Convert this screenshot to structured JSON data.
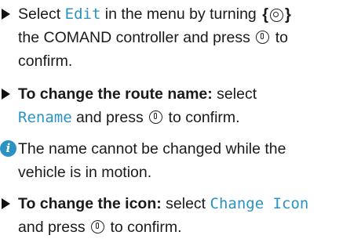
{
  "steps": [
    {
      "prefix": "Select ",
      "keyword": "Edit",
      "middle": " in the menu by turning ",
      "line2_a": "the COMAND controller and press ",
      "line2_b": " to",
      "line3": "confirm."
    },
    {
      "bold": "To change the route name:",
      "after_bold": " select",
      "keyword": "Rename",
      "suffix_a": " and press ",
      "suffix_b": " to confirm."
    },
    {
      "line1": "The name cannot be changed while the",
      "line2": "vehicle is in motion."
    },
    {
      "bold": "To change the icon:",
      "after_bold": " select ",
      "keyword": "Change Icon",
      "line2_a": "and press ",
      "line2_b": " to confirm."
    }
  ],
  "icons": {
    "bullet": "triangle-bullet-icon",
    "turn": "controller-turn-icon",
    "press": "controller-press-icon",
    "info": "info-icon"
  },
  "colors": {
    "keyword": "#2a93c4",
    "info": "#2a93c4"
  }
}
